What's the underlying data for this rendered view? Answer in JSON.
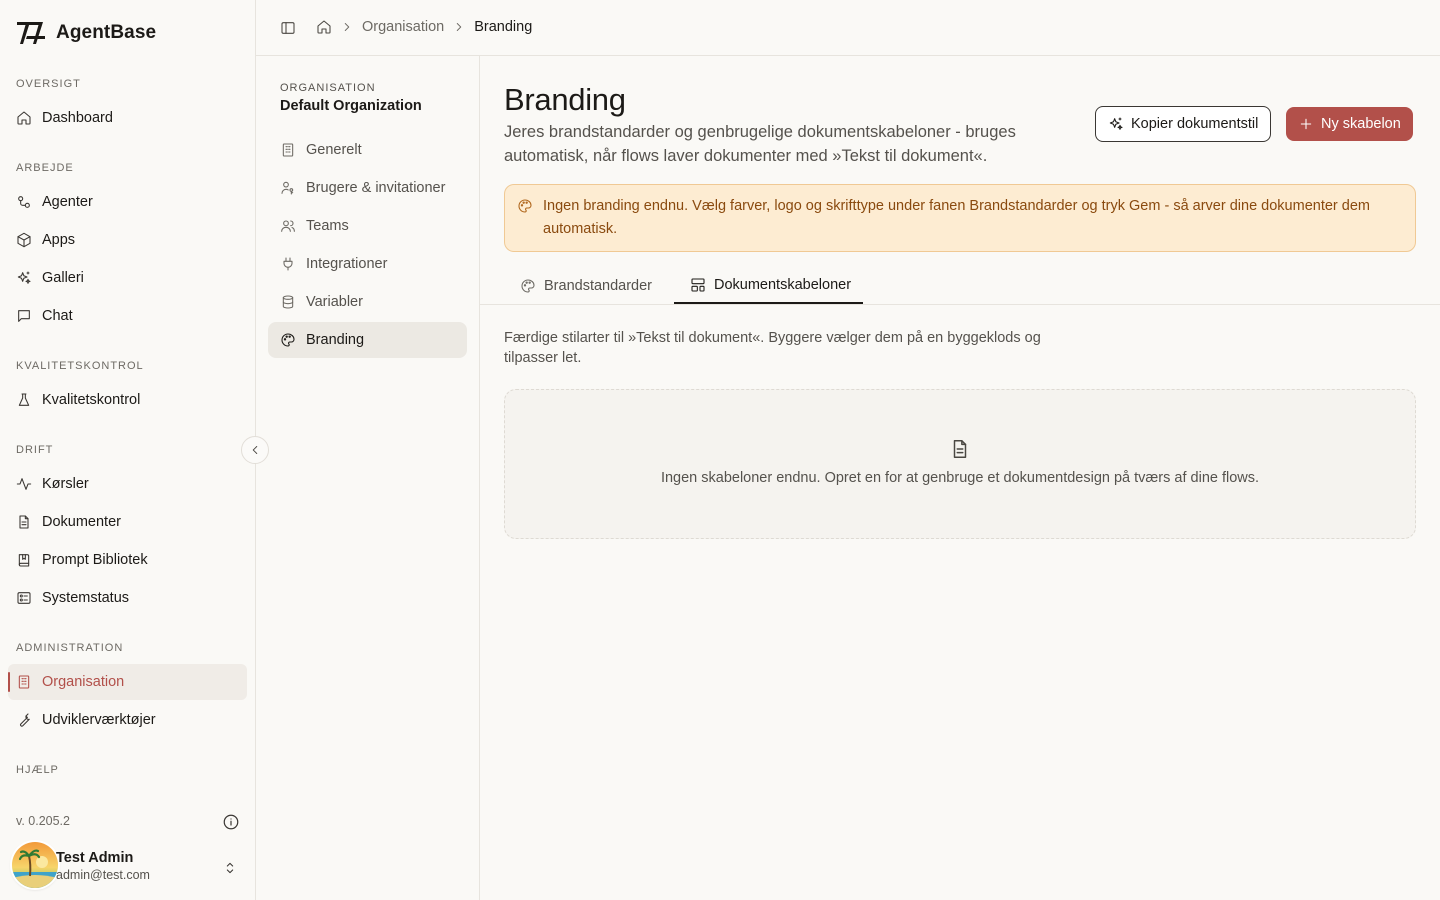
{
  "app": {
    "name": "AgentBase"
  },
  "sidebar": {
    "sections": {
      "overview": "OVERSIGT",
      "work": "ARBEJDE",
      "quality": "KVALITETSKONTROL",
      "operations": "DRIFT",
      "administration": "ADMINISTRATION",
      "help": "HJÆLP"
    },
    "items": {
      "dashboard": "Dashboard",
      "agents": "Agenter",
      "apps": "Apps",
      "gallery": "Galleri",
      "chat": "Chat",
      "quality_control": "Kvalitetskontrol",
      "runs": "Kørsler",
      "documents": "Dokumenter",
      "prompt_library": "Prompt Bibliotek",
      "system_status": "Systemstatus",
      "organisation": "Organisation",
      "developer_tools": "Udviklerværktøjer"
    },
    "active_item": "organisation",
    "version": "v. 0.205.2",
    "user": {
      "name": "Test Admin",
      "email": "admin@test.com"
    }
  },
  "breadcrumb": {
    "parent": "Organisation",
    "current": "Branding"
  },
  "subnav": {
    "label": "ORGANISATION",
    "org_name": "Default Organization",
    "items": {
      "general": "Generelt",
      "users": "Brugere & invitationer",
      "teams": "Teams",
      "integrations": "Integrationer",
      "variables": "Variabler",
      "branding": "Branding"
    },
    "active_item": "branding"
  },
  "page": {
    "title": "Branding",
    "description": "Jeres brandstandarder og genbrugelige dokumentskabeloner - bruges automatisk, når flows laver dokumenter med »Tekst til dokument«.",
    "copy_style_button": "Kopier dokumentstil",
    "new_template_button": "Ny skabelon",
    "alert": "Ingen branding endnu. Vælg farver, logo og skrifttype under fanen Brandstandarder og tryk Gem - så arver dine dokumenter dem automatisk.",
    "tabs": {
      "brand_standards": "Brandstandarder",
      "document_templates": "Dokumentskabeloner"
    },
    "active_tab": "document_templates",
    "tab_description": "Færdige stilarter til »Tekst til dokument«. Byggere vælger dem på en byggeklods og tilpasser let.",
    "empty_state": "Ingen skabeloner endnu. Opret en for at genbruge et dokumentdesign på tværs af dine flows."
  },
  "colors": {
    "accent": "#b2504a",
    "background": "#faf9f6",
    "alert_bg": "#fdecd2",
    "alert_border": "#f0c994",
    "alert_text": "#8a4a0f"
  }
}
